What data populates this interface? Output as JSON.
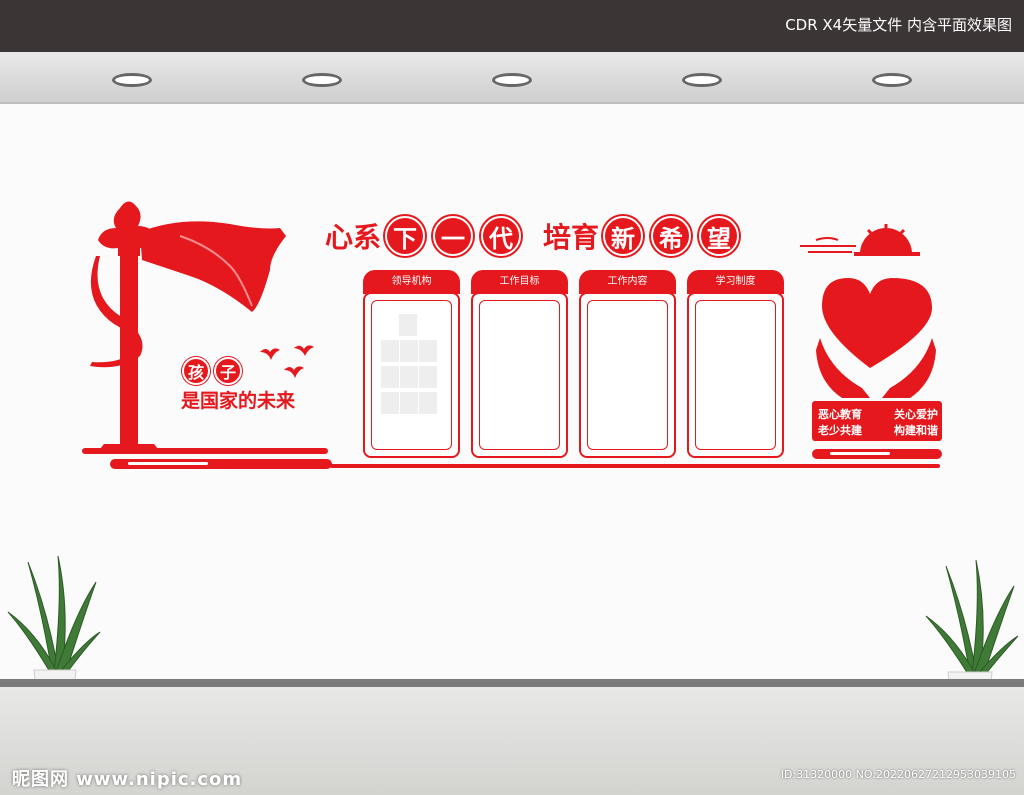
{
  "top_banner": {
    "text": "CDR X4矢量文件  内含平面效果图"
  },
  "headline": {
    "part1": "心系",
    "circled1": [
      "下",
      "一",
      "代"
    ],
    "part2": "培育",
    "circled2": [
      "新",
      "希",
      "望"
    ]
  },
  "left_slogan": {
    "circled": [
      "孩",
      "子"
    ],
    "line": "是国家的未来"
  },
  "panels": [
    {
      "title": "领导机构"
    },
    {
      "title": "工作目标"
    },
    {
      "title": "工作内容"
    },
    {
      "title": "学习制度"
    }
  ],
  "right_slogan": {
    "row1": [
      "恶心教育",
      "关心爱护"
    ],
    "row2": [
      "老少共建",
      "构建和谐"
    ]
  },
  "watermark": {
    "left": "昵图网 www.nipic.com",
    "right": "ID:31320000 NO:20220627212953039105"
  },
  "colors": {
    "brand_red": "#e5181d",
    "top_bar": "#3b3536"
  },
  "icons": [
    "ceiling-light-icon",
    "ornamental-pillar-icon",
    "flying-birds-icon",
    "heart-in-hands-icon",
    "rising-sun-icon",
    "potted-plant-icon"
  ]
}
